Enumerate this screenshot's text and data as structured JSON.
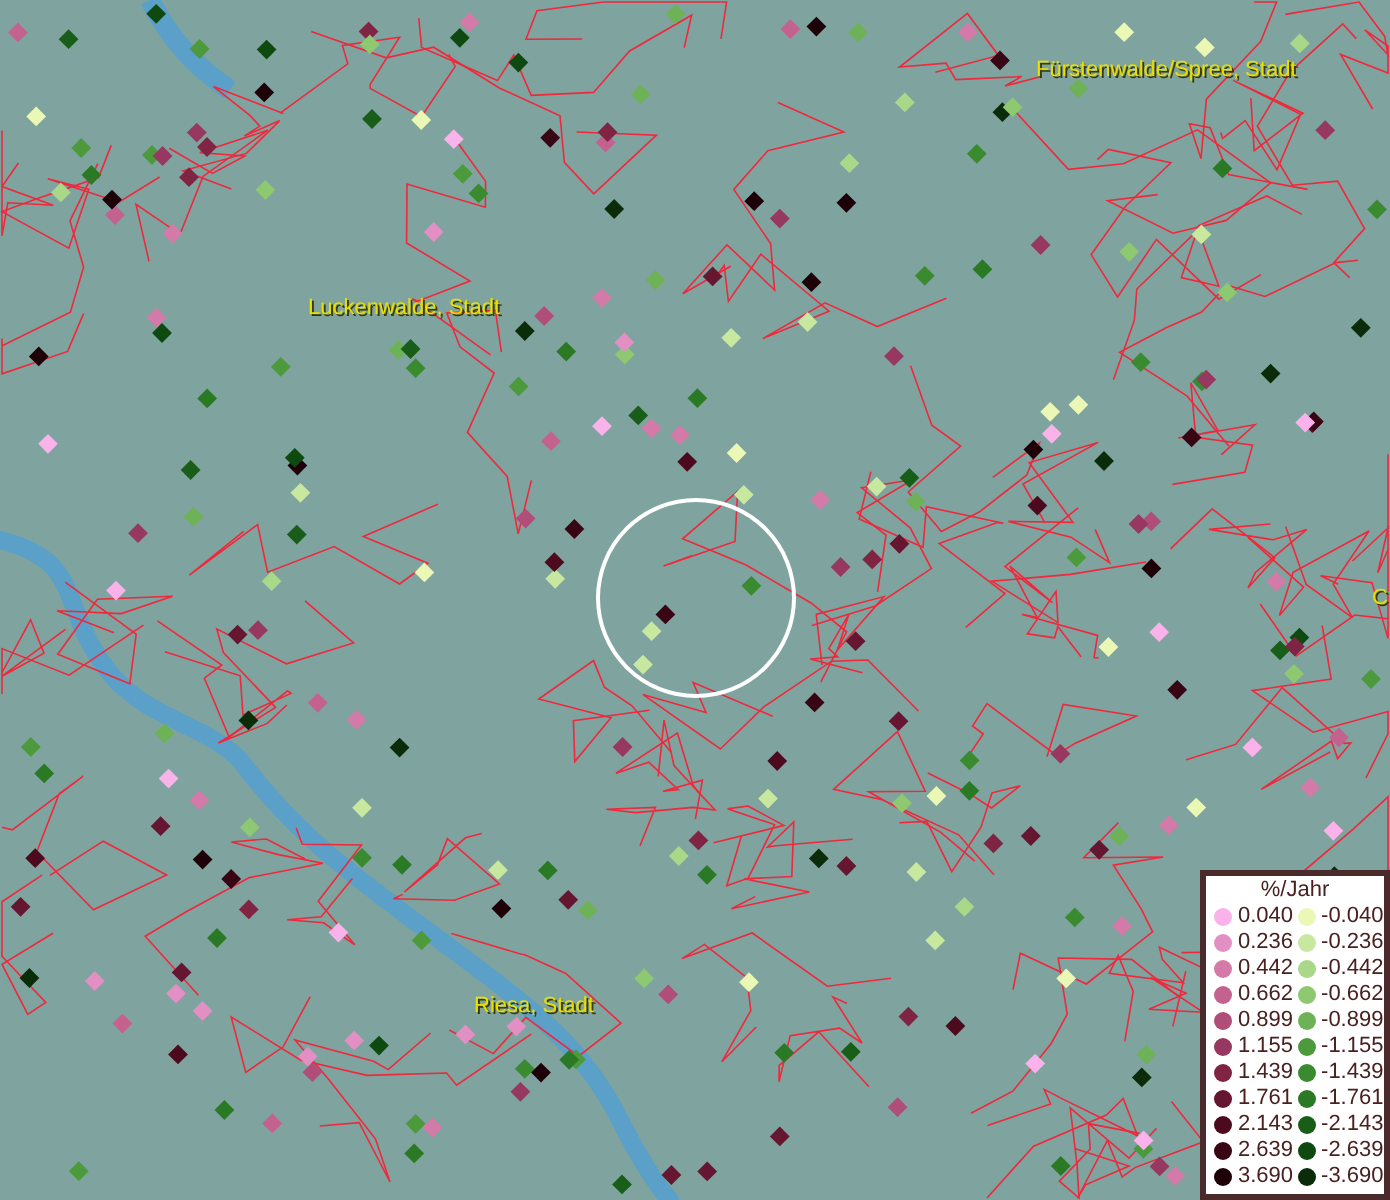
{
  "map": {
    "labels": [
      {
        "text": "Fürstenwalde/Spree, Stadt"
      },
      {
        "text": "Luckenwalde, Stadt"
      },
      {
        "text": "Riesa, Stadt"
      },
      {
        "text": "C"
      }
    ]
  },
  "legend": {
    "title": "%/Jahr",
    "columns": [
      {
        "items": [
          {
            "label": "0.040",
            "color": "#f9b3ea"
          },
          {
            "label": "0.236",
            "color": "#e28fc4"
          },
          {
            "label": "0.442",
            "color": "#d47aa8"
          },
          {
            "label": "0.662",
            "color": "#c4628f"
          },
          {
            "label": "0.899",
            "color": "#b04d78"
          },
          {
            "label": "1.155",
            "color": "#96385f"
          },
          {
            "label": "1.439",
            "color": "#7f2443"
          },
          {
            "label": "1.761",
            "color": "#651631"
          },
          {
            "label": "2.143",
            "color": "#4d0a1f"
          },
          {
            "label": "2.639",
            "color": "#380514"
          },
          {
            "label": "3.690",
            "color": "#1e0008"
          }
        ]
      },
      {
        "items": [
          {
            "label": "-0.040",
            "color": "#eaf7b5"
          },
          {
            "label": "-0.236",
            "color": "#c8e8a0"
          },
          {
            "label": "-0.442",
            "color": "#a8d888"
          },
          {
            "label": "-0.662",
            "color": "#8ec870"
          },
          {
            "label": "-0.899",
            "color": "#6db256"
          },
          {
            "label": "-1.155",
            "color": "#4c9a3c"
          },
          {
            "label": "-1.439",
            "color": "#3a8a30"
          },
          {
            "label": "-1.761",
            "color": "#2a7a25"
          },
          {
            "label": "-2.143",
            "color": "#185e18"
          },
          {
            "label": "-2.639",
            "color": "#0e4a10"
          },
          {
            "label": "-3.690",
            "color": "#0a2c08"
          }
        ]
      }
    ]
  }
}
